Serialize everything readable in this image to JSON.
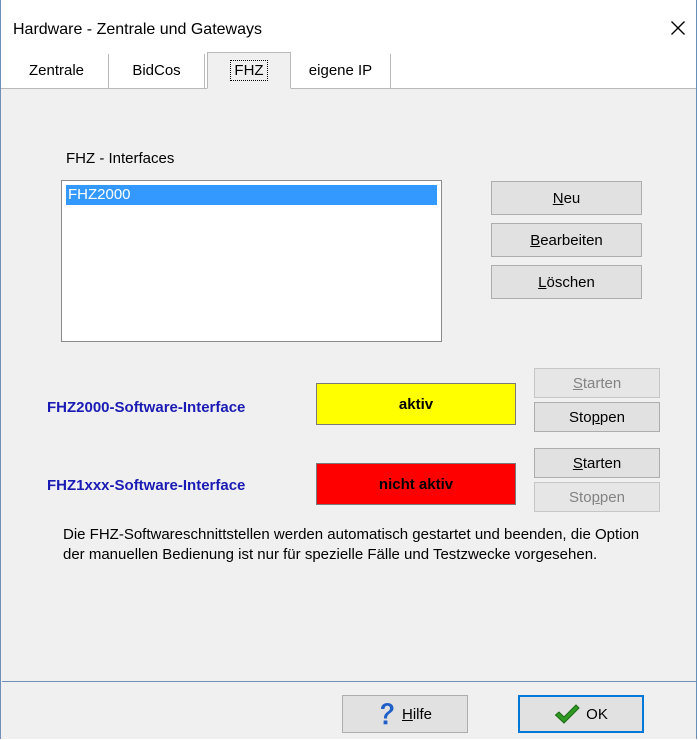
{
  "window": {
    "title": "Hardware  -  Zentrale und Gateways",
    "close_glyph": "✕"
  },
  "tabs": [
    {
      "label": "Zentrale",
      "active": false
    },
    {
      "label": "BidCos",
      "active": false
    },
    {
      "label": "FHZ",
      "active": true
    },
    {
      "label": "eigene IP",
      "active": false
    }
  ],
  "interfaces": {
    "heading": "FHZ - Interfaces",
    "items": [
      "FHZ2000"
    ],
    "selected": "FHZ2000"
  },
  "list_buttons": {
    "neu": {
      "label": "Neu",
      "mnemonic_index": 0
    },
    "bearbeiten": {
      "label": "Bearbeiten",
      "mnemonic_index": 0
    },
    "loeschen": {
      "label": "Löschen",
      "mnemonic_index": 0
    }
  },
  "software_interfaces": [
    {
      "name": "FHZ2000-Software-Interface",
      "status": "aktiv",
      "status_color": "#ffff00",
      "start_label": "Starten",
      "start_enabled": false,
      "stop_label": "Stoppen",
      "stop_enabled": true
    },
    {
      "name": "FHZ1xxx-Software-Interface",
      "status": "nicht aktiv",
      "status_color": "#ff0000",
      "start_label": "Starten",
      "start_enabled": true,
      "stop_label": "Stoppen",
      "stop_enabled": false
    }
  ],
  "info_text": "Die FHZ-Softwareschnittstellen werden automatisch gestartet und beenden, die Option der manuellen Bedienung ist nur für spezielle Fälle und Testzwecke vorgesehen.",
  "footer": {
    "help_label": "Hilfe",
    "help_icon": "question-mark-icon",
    "ok_label": "OK",
    "ok_icon": "checkmark-icon"
  },
  "colors": {
    "accent": "#0078d7",
    "selection": "#3399ff",
    "label_blue": "#1a1ab4"
  }
}
